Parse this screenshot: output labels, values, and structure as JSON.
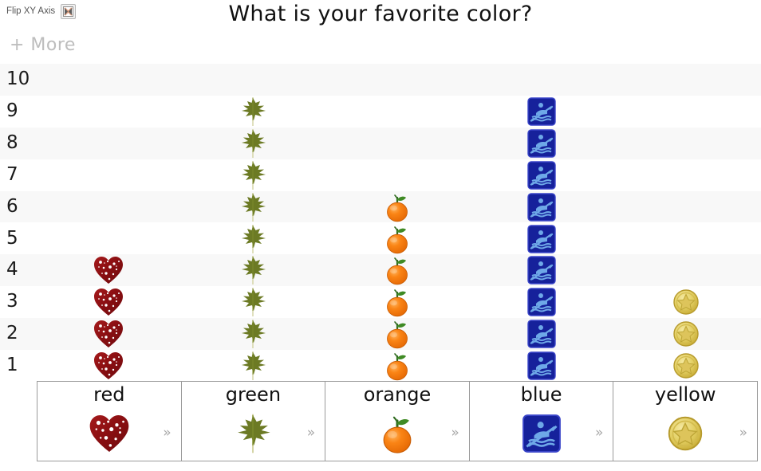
{
  "toolbar": {
    "flip_label": "Flip XY Axis",
    "flip_icon": "flip-xy-axis-icon",
    "more_label": "+ More"
  },
  "header": {
    "title": "What is your favorite color?"
  },
  "colors": {
    "row_stripe": "#f8f8f8",
    "row_plain": "#ffffff",
    "title_text": "#111111",
    "more_text": "#bdbdbd",
    "grid_border": "#9a9a9a",
    "red_icon": "#8f1013",
    "green_icon": "#6b7a22",
    "orange_icon": "#f57c14",
    "blue_icon": "#16219b",
    "yellow_icon": "#d9bf45"
  },
  "chart_data": {
    "type": "bar",
    "subtype": "pictograph",
    "title": "What is your favorite color?",
    "xlabel": "",
    "ylabel": "",
    "categories": [
      "red",
      "green",
      "orange",
      "blue",
      "yellow"
    ],
    "values": [
      4,
      9,
      6,
      9,
      3
    ],
    "ylim": [
      0,
      10
    ],
    "yticks": [
      "10",
      "9",
      "8",
      "7",
      "6",
      "5",
      "4",
      "3",
      "2",
      "1"
    ],
    "grid": true,
    "legend": "bottom",
    "icons": [
      "heart-icon",
      "leaf-icon",
      "orange-fruit-icon",
      "kayak-icon",
      "star-coin-icon"
    ]
  },
  "legend": {
    "chevron": "»",
    "cells": [
      {
        "label": "red",
        "icon": "heart-icon"
      },
      {
        "label": "green",
        "icon": "leaf-icon"
      },
      {
        "label": "orange",
        "icon": "orange-fruit-icon"
      },
      {
        "label": "blue",
        "icon": "kayak-icon"
      },
      {
        "label": "yellow",
        "icon": "star-coin-icon"
      }
    ]
  }
}
